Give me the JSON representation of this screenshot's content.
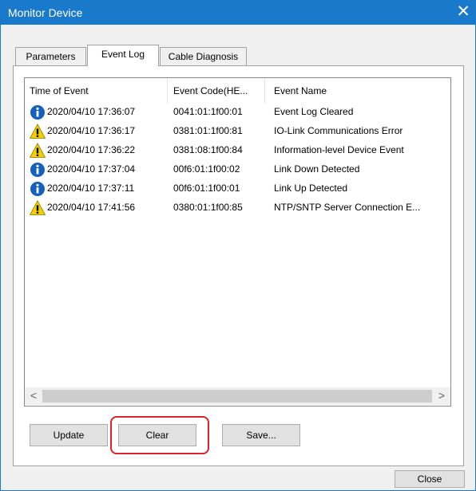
{
  "window": {
    "title": "Monitor Device",
    "close_glyph": "✕"
  },
  "tabs": [
    {
      "label": "Parameters",
      "active": false
    },
    {
      "label": "Event Log",
      "active": true
    },
    {
      "label": "Cable Diagnosis",
      "active": false
    }
  ],
  "event_log": {
    "columns": [
      "Time of Event",
      "Event Code(HE...",
      "Event Name"
    ],
    "rows": [
      {
        "icon": "info-icon",
        "time": "2020/04/10 17:36:07",
        "code": "0041:01:1f00:01",
        "name": "Event Log Cleared"
      },
      {
        "icon": "warning-icon",
        "time": "2020/04/10 17:36:17",
        "code": "0381:01:1f00:81",
        "name": "IO-Link Communications Error"
      },
      {
        "icon": "warning-icon",
        "time": "2020/04/10 17:36:22",
        "code": "0381:08:1f00:84",
        "name": "Information-level Device Event"
      },
      {
        "icon": "info-icon",
        "time": "2020/04/10 17:37:04",
        "code": "00f6:01:1f00:02",
        "name": "Link Down Detected"
      },
      {
        "icon": "info-icon",
        "time": "2020/04/10 17:37:11",
        "code": "00f6:01:1f00:01",
        "name": "Link Up Detected"
      },
      {
        "icon": "warning-icon",
        "time": "2020/04/10 17:41:56",
        "code": "0380:01:1f00:85",
        "name": "NTP/SNTP Server Connection E..."
      }
    ]
  },
  "scrollbar": {
    "left_arrow": "<",
    "right_arrow": ">"
  },
  "buttons": {
    "update": "Update",
    "clear": "Clear",
    "save": "Save...",
    "close": "Close"
  },
  "colors": {
    "titlebar": "#1979ca",
    "highlight": "#d9232e",
    "info": "#1560bd",
    "warning": "#f5d000"
  }
}
